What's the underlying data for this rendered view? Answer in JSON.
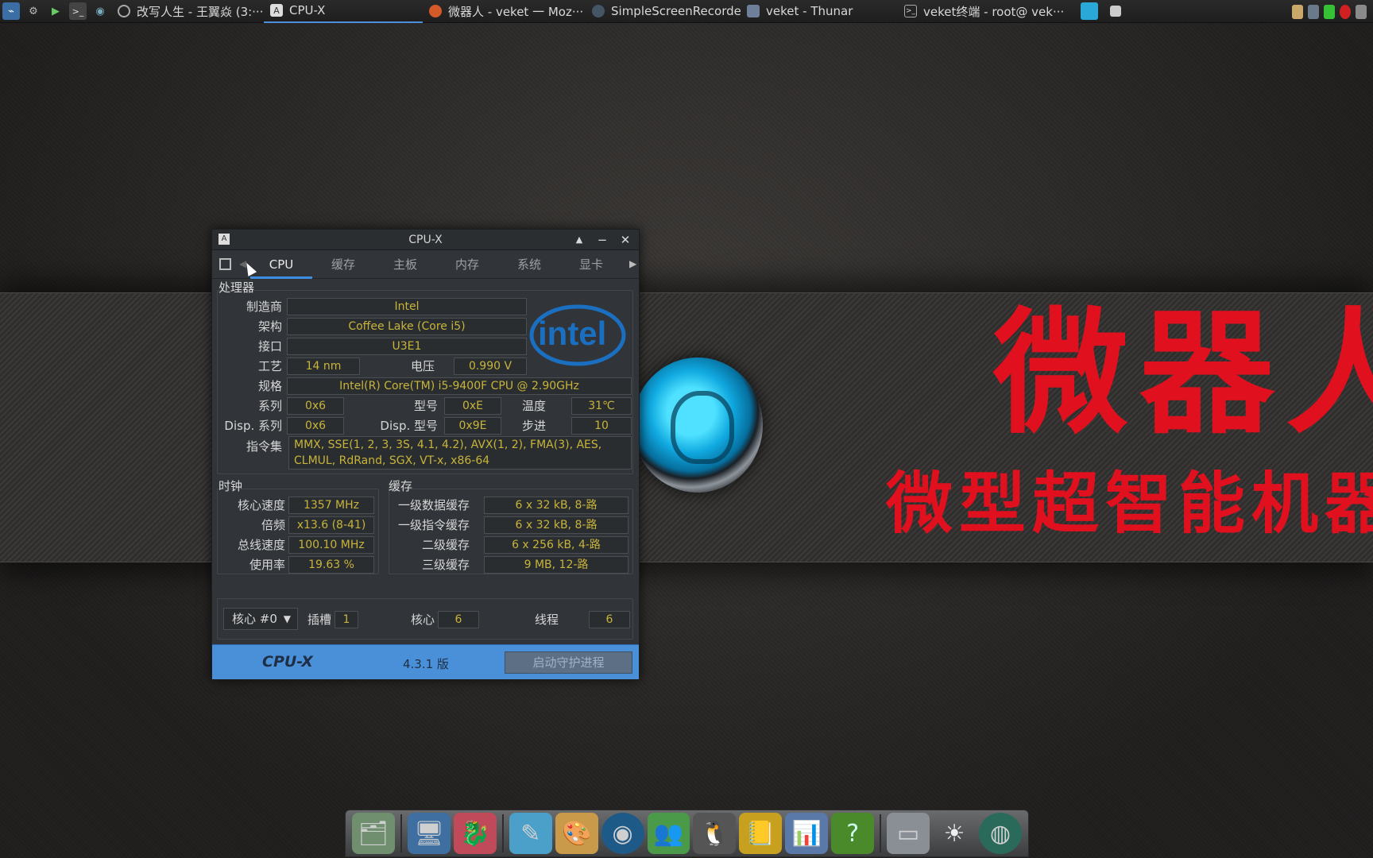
{
  "taskbar": {
    "tasks": [
      {
        "label": "改写人生 - 王翼焱 (3:···",
        "icon": "record-icon",
        "active": false
      },
      {
        "label": "CPU-X",
        "icon": "cpux-icon",
        "active": true
      },
      {
        "label": "微器人 - veket 一 Moz···",
        "icon": "firefox-icon",
        "active": false
      },
      {
        "label": "SimpleScreenRecorder",
        "icon": "recorder-icon",
        "active": false
      },
      {
        "label": "veket - Thunar",
        "icon": "folder-icon",
        "active": false
      },
      {
        "label": "veket终端 - root@ vek···",
        "icon": "terminal-icon",
        "active": false
      }
    ]
  },
  "desktop": {
    "brand_big": "微器人",
    "brand_small": "微型超智能机器"
  },
  "window": {
    "title": "CPU-X",
    "tabs": [
      "CPU",
      "缓存",
      "主板",
      "内存",
      "系统",
      "显卡"
    ],
    "processor": {
      "group_label": "处理器",
      "vendor_label": "制造商",
      "vendor": "Intel",
      "arch_label": "架构",
      "arch": "Coffee Lake (Core i5)",
      "socket_label": "接口",
      "socket": "U3E1",
      "tech_label": "工艺",
      "tech": "14 nm",
      "voltage_label": "电压",
      "voltage": "0.990 V",
      "spec_label": "规格",
      "spec": "Intel(R) Core(TM) i5-9400F CPU @ 2.90GHz",
      "family_label": "系列",
      "family": "0x6",
      "model_label": "型号",
      "model": "0xE",
      "temp_label": "温度",
      "temp": "31℃",
      "dfamily_label": "Disp. 系列",
      "dfamily": "0x6",
      "dmodel_label": "Disp. 型号",
      "dmodel": "0x9E",
      "stepping_label": "步进",
      "stepping": "10",
      "instr_label": "指令集",
      "instr": "MMX, SSE(1, 2, 3, 3S, 4.1, 4.2), AVX(1, 2), FMA(3), AES, CLMUL, RdRand, SGX, VT-x, x86-64"
    },
    "clocks": {
      "group_label": "时钟",
      "core_speed_label": "核心速度",
      "core_speed": "1357 MHz",
      "multiplier_label": "倍频",
      "multiplier": "x13.6 (8-41)",
      "bus_label": "总线速度",
      "bus": "100.10 MHz",
      "usage_label": "使用率",
      "usage": "19.63 %"
    },
    "cache": {
      "group_label": "缓存",
      "l1d_label": "一级数据缓存",
      "l1d": "6 x 32 kB, 8-路",
      "l1i_label": "一级指令缓存",
      "l1i": "6 x 32 kB, 8-路",
      "l2_label": "二级缓存",
      "l2": "6 x 256 kB, 4-路",
      "l3_label": "三级缓存",
      "l3": "9 MB, 12-路"
    },
    "bottom": {
      "core_select": "核心 #0",
      "socket_label": "插槽",
      "socket": "1",
      "cores_label": "核心",
      "cores": "6",
      "threads_label": "线程",
      "threads": "6"
    },
    "footer": {
      "brand": "CPU-X",
      "version": "4.3.1 版",
      "daemon_button": "启动守护进程"
    },
    "intel_logo_text": "intel"
  },
  "colors": {
    "accent": "#4a90d9",
    "value_text": "#c8b43a",
    "brand_red": "#e0101e"
  }
}
